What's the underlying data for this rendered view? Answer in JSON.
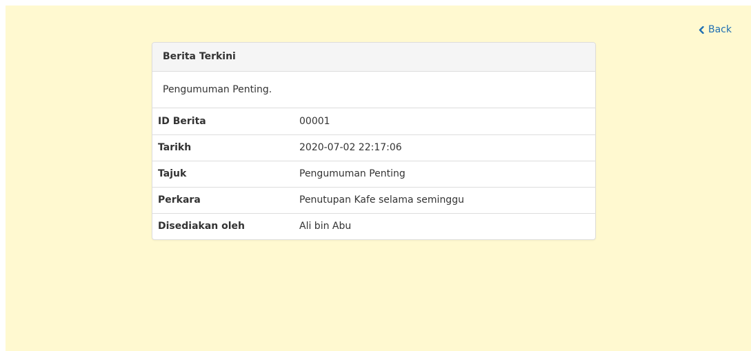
{
  "nav": {
    "back_label": "Back"
  },
  "panel": {
    "heading": "Berita Terkini",
    "body": "Pengumuman Penting."
  },
  "details": [
    {
      "label": "ID Berita",
      "value": "00001"
    },
    {
      "label": "Tarikh",
      "value": "2020-07-02 22:17:06"
    },
    {
      "label": "Tajuk",
      "value": "Pengumuman Penting"
    },
    {
      "label": "Perkara",
      "value": "Penutupan Kafe selama seminggu"
    },
    {
      "label": "Disediakan oleh",
      "value": "Ali bin Abu"
    }
  ],
  "colors": {
    "background": "#fff9d0",
    "link": "#1f6fb2",
    "panel_heading_bg": "#f5f5f5",
    "border": "#dddddd"
  },
  "icons": {
    "back": "chevron-left-icon"
  }
}
